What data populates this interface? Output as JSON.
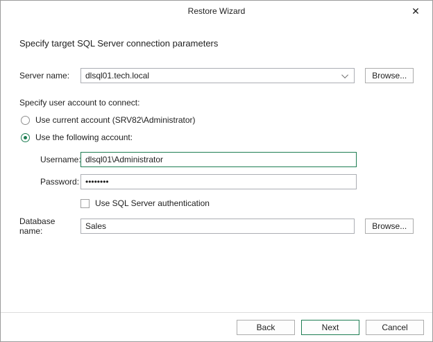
{
  "window": {
    "title": "Restore Wizard",
    "close_glyph": "✕"
  },
  "heading": "Specify target SQL Server connection parameters",
  "form": {
    "server": {
      "label": "Server name:",
      "value": "dlsql01.tech.local",
      "browse_label": "Browse..."
    },
    "account_section_label": "Specify user account to connect:",
    "use_current_account": {
      "label": "Use current account (SRV82\\Administrator)",
      "selected": false
    },
    "use_following_account": {
      "label": "Use the following account:",
      "selected": true
    },
    "username": {
      "label": "Username:",
      "value": "dlsql01\\Administrator"
    },
    "password": {
      "label": "Password:",
      "value": "••••••••"
    },
    "sql_auth": {
      "label": "Use SQL Server authentication",
      "checked": false
    },
    "database": {
      "label": "Database name:",
      "value": "Sales",
      "browse_label": "Browse..."
    }
  },
  "footer": {
    "back_label": "Back",
    "next_label": "Next",
    "cancel_label": "Cancel"
  },
  "colors": {
    "accent_green": "#1d7d52",
    "input_border": "#abadb3"
  }
}
